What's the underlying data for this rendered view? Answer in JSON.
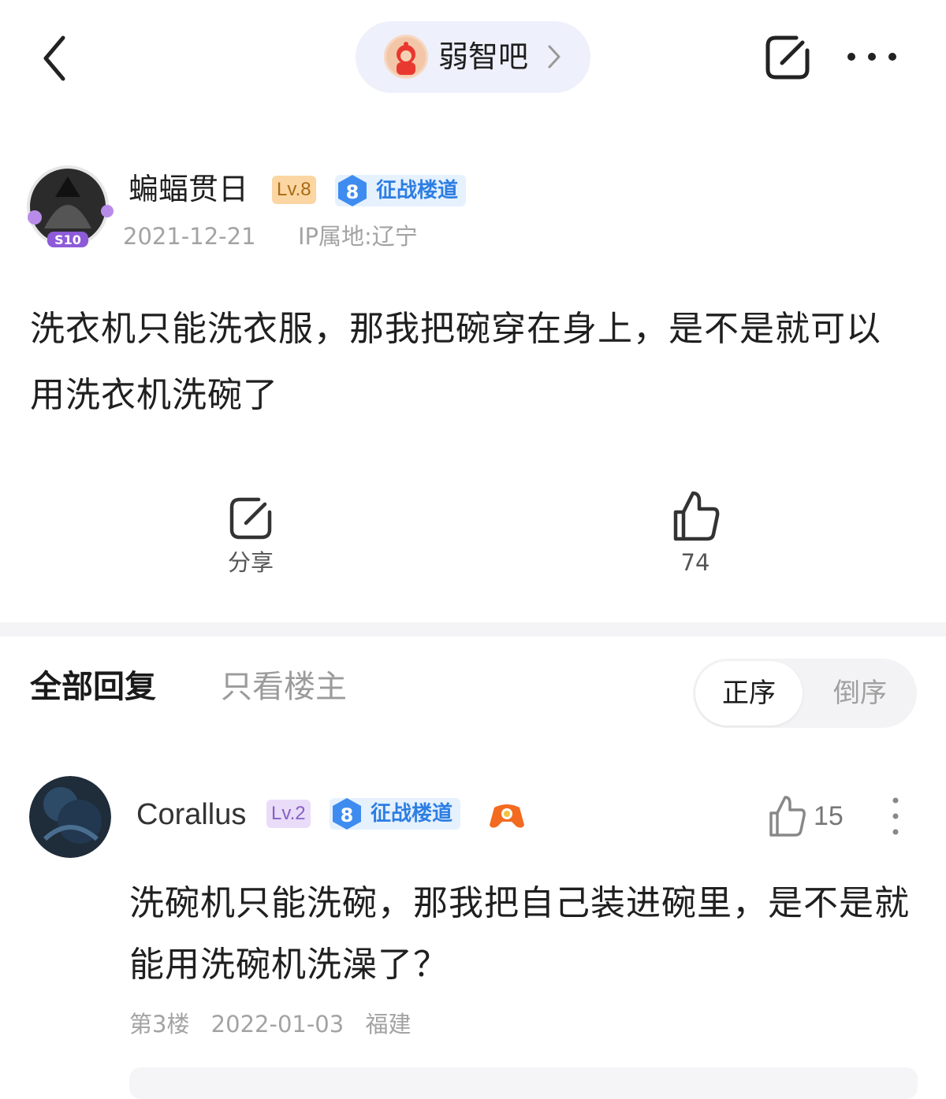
{
  "header": {
    "forum_name": "弱智吧"
  },
  "post": {
    "author": {
      "name": "蝙蝠贯日",
      "level": "Lv.8",
      "title_level": "8",
      "title": "征战楼道",
      "avatar_badge": "S10"
    },
    "date": "2021-12-21",
    "ip_location": "IP属地:辽宁",
    "content": "洗衣机只能洗衣服，那我把碗穿在身上，是不是就可以用洗衣机洗碗了",
    "share_label": "分享",
    "like_count": "74"
  },
  "replies": {
    "tab_all": "全部回复",
    "tab_op_only": "只看楼主",
    "sort_asc": "正序",
    "sort_desc": "倒序"
  },
  "comments": [
    {
      "name": "Corallus",
      "level": "Lv.2",
      "title_level": "8",
      "title": "征战楼道",
      "like_count": "15",
      "content": "洗碗机只能洗碗，那我把自己装进碗里，是不是就能用洗碗机洗澡了？",
      "floor": "第3楼",
      "date": "2022-01-03",
      "location": "福建"
    }
  ],
  "colors": {
    "accent_blue": "#2d7ee3",
    "pill_bg": "#eef0fb",
    "lv8_badge": "#fbd6a3",
    "lv2_badge": "#e9dcf8"
  }
}
